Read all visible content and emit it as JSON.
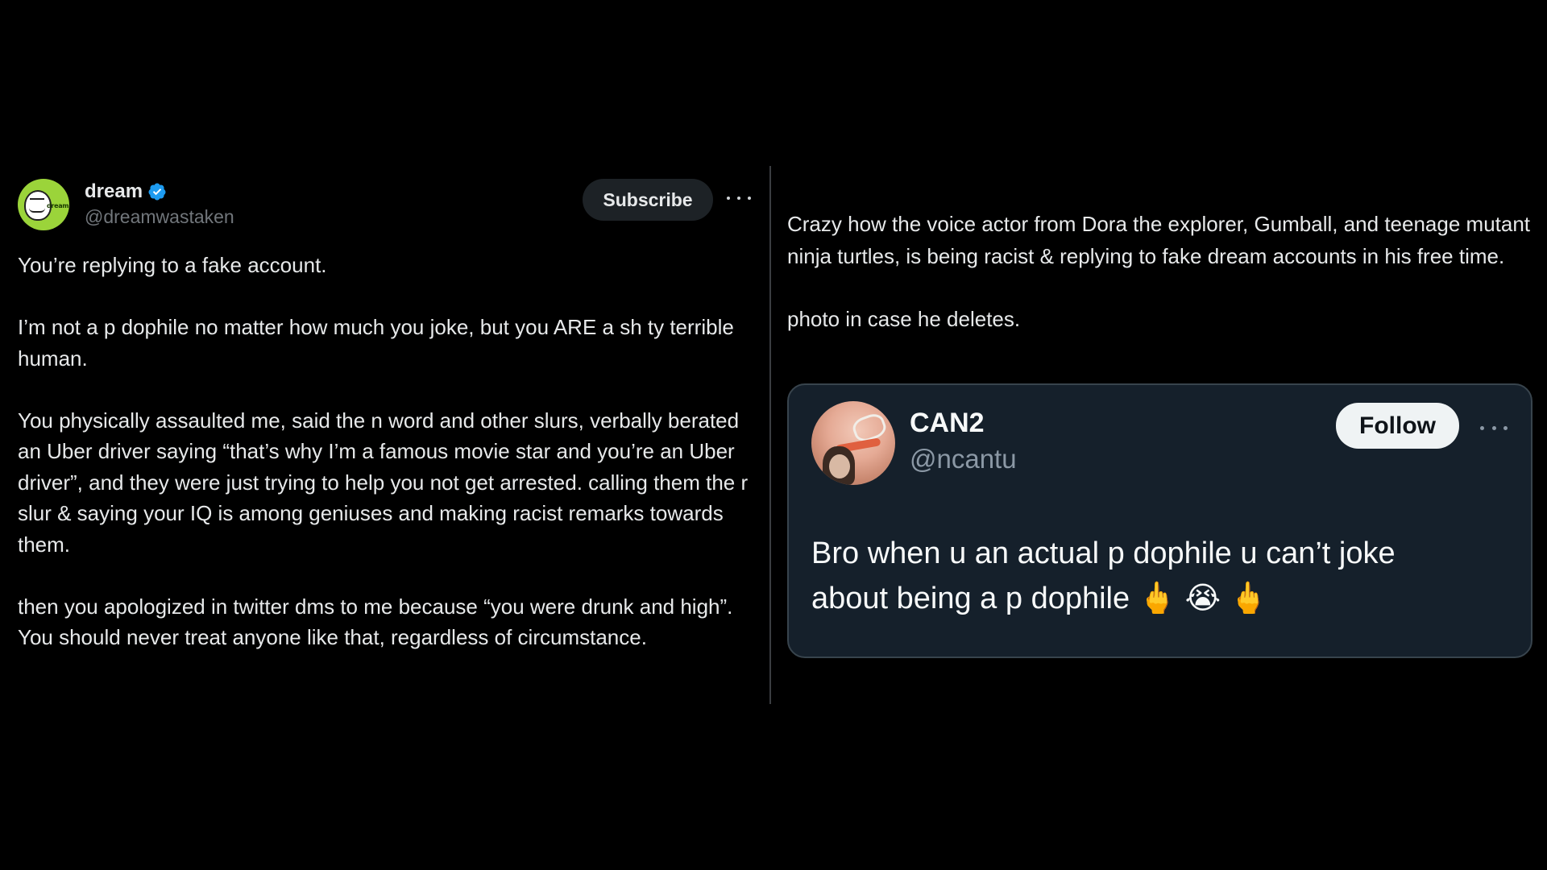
{
  "left_tweet": {
    "display_name": "dream",
    "handle": "@dreamwastaken",
    "avatar_icon": "dream-mascot-icon",
    "verified_icon": "verified-badge-icon",
    "verified_color": "#1d9bf0",
    "subscribe_label": "Subscribe",
    "more_icon": "more-horizontal-icon",
    "paragraphs": [
      "You’re replying to a fake account.",
      "I’m not a p  dophile no matter how much you joke, but you ARE a sh  ty terrible human.",
      "You physically assaulted me, said the n word and other slurs, verbally berated an Uber driver saying “that’s why I’m a famous movie star and you’re an Uber driver”, and they were just trying to help you not get arrested. calling them the r slur & saying your IQ is among geniuses and making racist remarks towards them.",
      "then you apologized in twitter dms to me because “you were drunk and high”. You should never treat anyone like that, regardless of circumstance."
    ]
  },
  "right_post": {
    "paragraphs": [
      "Crazy how the voice actor from Dora the explorer, Gumball, and teenage mutant ninja turtles, is being racist & replying to fake dream accounts in his free time.",
      "photo in case he deletes."
    ]
  },
  "quoted_card": {
    "display_name": "CAN2",
    "handle": "@ncantu",
    "avatar_icon": "user-avatar-icon",
    "follow_label": "Follow",
    "more_icon": "more-horizontal-icon",
    "text_line1": "Bro when u an actual p  dophile u can’t joke",
    "text_line2": "about being a p  dophile",
    "emojis": [
      "🖕",
      "😭",
      "🖕"
    ],
    "background": "#15202b"
  }
}
